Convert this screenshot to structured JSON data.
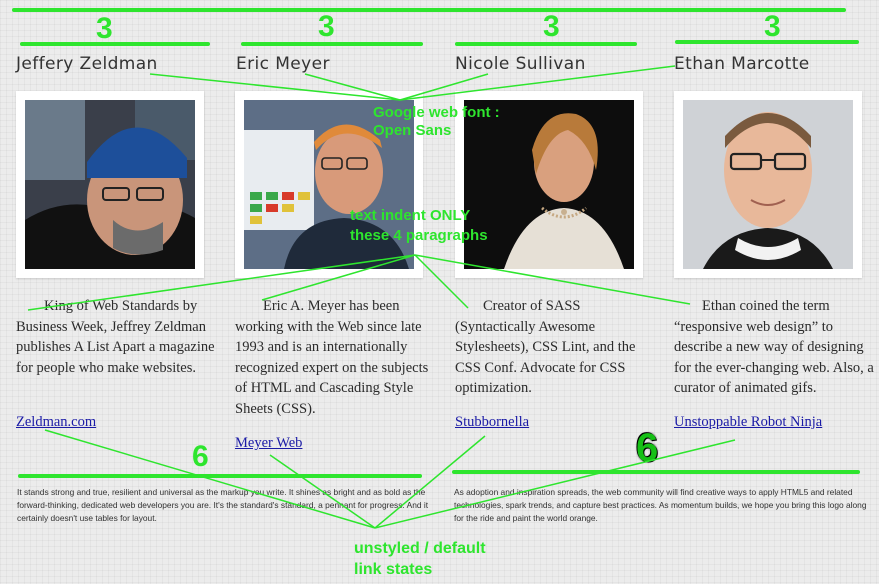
{
  "people": [
    {
      "name": "Jeffery Zeldman",
      "bio": "King of Web Standards by Business Week, Jeffrey Zeldman publishes A List Apart a magazine for people who make websites.",
      "link": "Zeldman.com",
      "photo": "portrait-man-beanie"
    },
    {
      "name": "Eric Meyer",
      "bio": "Eric A. Meyer has been working with the Web since late 1993 and is an internationally recognized expert on the subjects of HTML and Cascading Style Sheets (CSS).",
      "link": "Meyer Web",
      "photo": "portrait-man-glasses-speaking"
    },
    {
      "name": "Nicole Sullivan",
      "bio": "Creator of SASS (Syntactically Awesome Stylesheets), CSS Lint, and the CSS Conf. Advocate for CSS optimization.",
      "link": "Stubbornella",
      "photo": "portrait-woman-speaking"
    },
    {
      "name": "Ethan Marcotte",
      "bio": "Ethan coined the term “responsive web design” to describe a new way of designing for the ever-changing web. Also, a curator of animated gifs.",
      "link": "Unstoppable Robot Ninja",
      "photo": "portrait-man-glasses"
    }
  ],
  "footer": {
    "left": "It stands strong and true, resilient and universal as the markup you write. It shines as bright and as bold as the forward-thinking, dedicated web developers you are. It's the standard's standard, a pennant for progress. And it certainly doesn't use tables for layout.",
    "right": "As adoption and inspiration spreads, the web community will find creative ways to apply HTML5 and related technologies, spark trends, and capture best practices. As momentum builds, we hope you bring this logo along for the ride and paint the world orange."
  },
  "annotations": {
    "column_numbers": [
      "3",
      "3",
      "3",
      "3"
    ],
    "footer_numbers": [
      "6",
      "6"
    ],
    "font_note_line1": "Google web font :",
    "font_note_line2": "Open Sans",
    "indent_note_line1": "text indent ONLY",
    "indent_note_line2": "these 4 paragraphs",
    "links_note_line1": "unstyled / default",
    "links_note_line2": "link states"
  },
  "colors": {
    "annotation": "#2ee52e",
    "link": "#1a1aa6",
    "background": "#ececec"
  }
}
